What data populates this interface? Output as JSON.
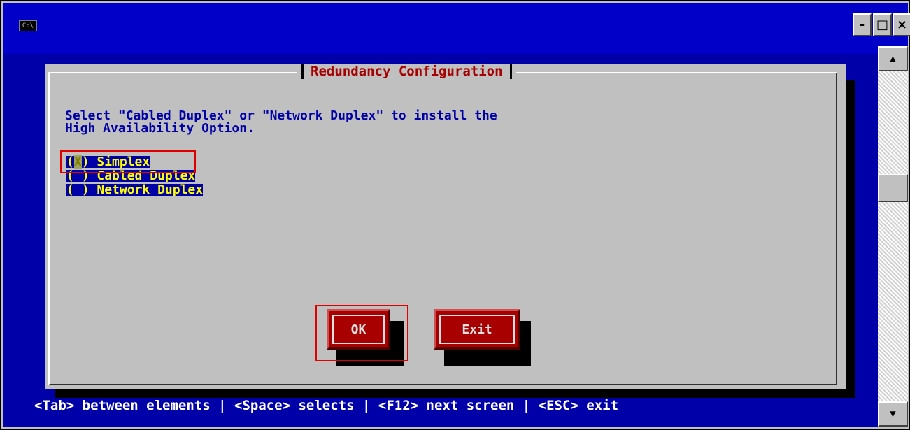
{
  "window": {
    "icon_text": "C:\\",
    "minimize": "-",
    "maximize": "□",
    "close": "×"
  },
  "scrollbar": {
    "up": "▲",
    "down": "▼"
  },
  "dialog": {
    "title": "Redundancy Configuration",
    "prompt_line1": "Select \"Cabled Duplex\" or \"Network Duplex\" to install the",
    "prompt_line2": "High Availability Option.",
    "options": [
      {
        "marker_open": "(",
        "marker_mark": "X",
        "marker_close": ")",
        "label": " Simplex",
        "selected": true
      },
      {
        "marker_open": "(",
        "marker_mark": " ",
        "marker_close": ")",
        "label": " Cabled Duplex",
        "selected": false
      },
      {
        "marker_open": "(",
        "marker_mark": " ",
        "marker_close": ")",
        "label": " Network Duplex",
        "selected": false
      }
    ],
    "buttons": {
      "ok": "OK",
      "exit": "Exit"
    }
  },
  "statusline": "<Tab> between elements | <Space> selects | <F12> next screen | <ESC> exit",
  "colors": {
    "console_bg": "#0000a8",
    "dialog_bg": "#c0c0c0",
    "title_text": "#a80000",
    "prompt_text": "#0000a8",
    "option_text": "#ffff00",
    "button_bg": "#a80000",
    "highlight": "#e00000"
  }
}
